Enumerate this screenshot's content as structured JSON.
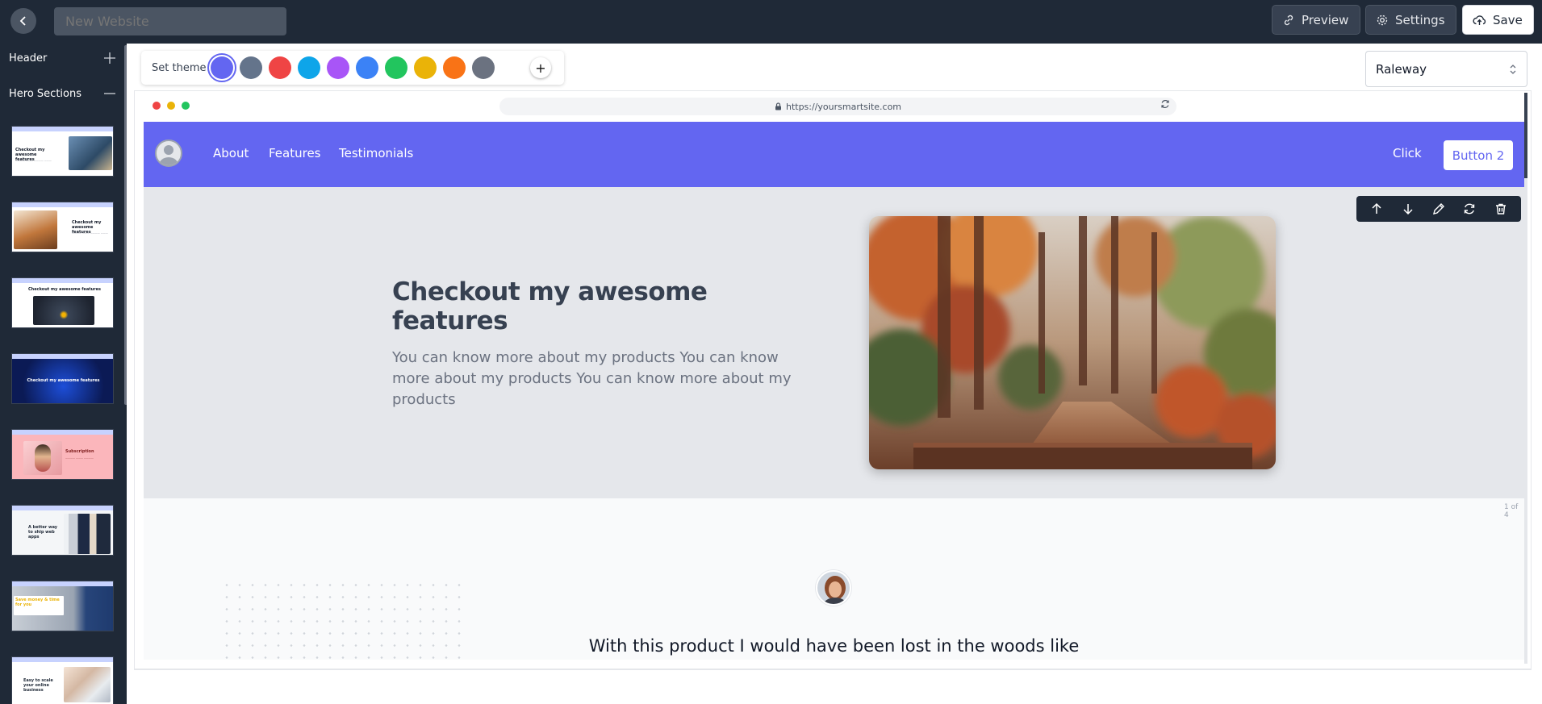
{
  "topbar": {
    "site_name_placeholder": "New Website",
    "preview_label": "Preview",
    "settings_label": "Settings",
    "save_label": "Save"
  },
  "sidebar": {
    "header_label": "Header",
    "hero_label": "Hero Sections",
    "thumbnails": [
      {
        "title": "Checkout my awesome features"
      },
      {
        "title": "Checkout my awesome features"
      },
      {
        "title": "Checkout my awesome features"
      },
      {
        "title": "Checkout my awesome features"
      },
      {
        "title": "Subscription"
      },
      {
        "title": "A better way to ship web apps"
      },
      {
        "title": "Save money & time for you"
      },
      {
        "title": "Easy to scale your online business"
      }
    ]
  },
  "theme": {
    "label": "Set theme",
    "colors": [
      "#6366f1",
      "#64748b",
      "#ef4444",
      "#0ea5e9",
      "#a855f7",
      "#3b82f6",
      "#22c55e",
      "#eab308",
      "#f97316",
      "#6b7280"
    ],
    "add_label": "+"
  },
  "font": {
    "selected": "Raleway"
  },
  "browser": {
    "url": "https://yoursmartsite.com"
  },
  "site_nav": {
    "links": [
      "About",
      "Features",
      "Testimonials"
    ],
    "click_label": "Click",
    "button2_label": "Button 2"
  },
  "hero": {
    "title": "Checkout my awesome features",
    "text": "You can know more about my products You can know more about my products You can know more about my products"
  },
  "testimonial": {
    "page_count": "1 of 4",
    "quote": "With this product I would have been lost in the woods like"
  },
  "colors": {
    "dark": "#1f2937",
    "accent": "#6366f1"
  }
}
